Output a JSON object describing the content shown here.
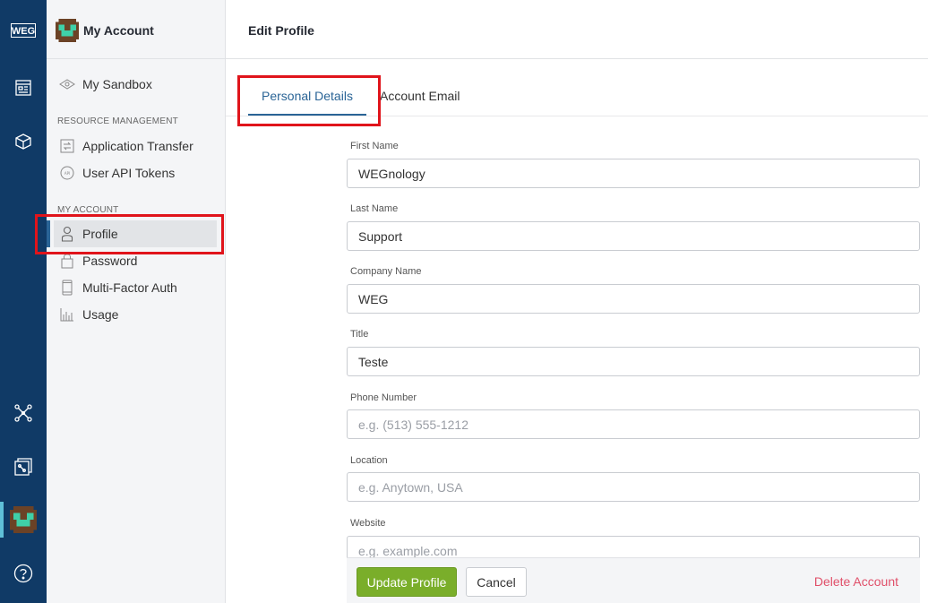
{
  "rail": {
    "logo": "WEG",
    "items": [
      {
        "icon": "dashboard-icon"
      },
      {
        "icon": "cube-icon"
      },
      {
        "icon": "network-icon"
      },
      {
        "icon": "gallery-icon"
      },
      {
        "icon": "user-avatar-icon"
      },
      {
        "icon": "help-icon"
      }
    ]
  },
  "sidebar": {
    "title": "My Account",
    "sandbox_label": "My Sandbox",
    "sections": {
      "resource_management": "RESOURCE MANAGEMENT",
      "my_account": "MY ACCOUNT"
    },
    "items": {
      "application_transfer": "Application Transfer",
      "user_api_tokens": "User API Tokens",
      "profile": "Profile",
      "password": "Password",
      "multi_factor_auth": "Multi-Factor Auth",
      "usage": "Usage"
    }
  },
  "header": {
    "title": "Edit Profile"
  },
  "tabs": {
    "personal_details": "Personal Details",
    "account_email": "Account Email"
  },
  "form": {
    "first_name": {
      "label": "First Name",
      "value": "WEGnology"
    },
    "last_name": {
      "label": "Last Name",
      "value": "Support"
    },
    "company_name": {
      "label": "Company Name",
      "value": "WEG"
    },
    "title": {
      "label": "Title",
      "value": "Teste"
    },
    "phone_number": {
      "label": "Phone Number",
      "placeholder": "e.g. (513) 555-1212"
    },
    "location": {
      "label": "Location",
      "placeholder": "e.g. Anytown, USA"
    },
    "website": {
      "label": "Website",
      "placeholder": "e.g. example.com"
    }
  },
  "footer": {
    "update_label": "Update Profile",
    "cancel_label": "Cancel",
    "delete_label": "Delete Account"
  },
  "colors": {
    "rail_bg": "#103a66",
    "accent": "#2a6496",
    "primary_button": "#7aae2a",
    "danger": "#e0506a",
    "highlight": "#e0141b"
  }
}
